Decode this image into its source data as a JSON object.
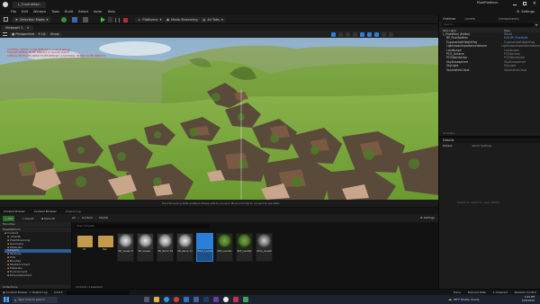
{
  "app": {
    "tab_title": "L_TundraMain",
    "window_title": "PixelPlatform",
    "settings_label": "Settings"
  },
  "menu": [
    "File",
    "Edit",
    "Window",
    "Tools",
    "Build",
    "Select",
    "Actor",
    "Help"
  ],
  "toolbar": {
    "mode_label": "Selection Mode",
    "platforms_label": "Platforms",
    "mode_button_label": "Mode Streaming",
    "tabs_label": "All Tabs"
  },
  "viewport": {
    "tab_label": "Viewport 1",
    "perspective_label": "Perspective",
    "lit_label": "Lit",
    "show_label": "Show",
    "warning_lines": [
      "LIGHTING NEEDS TO BE REBUILT (1 unbuilt object)",
      "FOLIAGE NEEDS TO BE REBUILT (1 unbuilt object)",
      "VIRTUAL TEXTURES NEED TO BE REBUILT (1 MATERIAL NEEDS TO BE REBUILT)"
    ],
    "status_text": "Pixel Streaming stats enabled. Please wait to connect. Move and look to connect to see stats."
  },
  "outliner": {
    "tab_label": "Outliner",
    "tab2_label": "Levels",
    "tab3_label": "Components",
    "search_placeholder": "Search...",
    "col_label": "Item Label",
    "col_type": "Type",
    "rows": [
      {
        "name": "L_PixelMain (Editor)",
        "type": "World"
      },
      {
        "name": "BP_PixelSplitter",
        "type": "Edit BP_PixelSplit"
      },
      {
        "name": "ExponentialHeightFog",
        "type": "ExponentialHeightFog"
      },
      {
        "name": "LightmassImportanceVolume",
        "type": "LightmassImportanceVolume"
      },
      {
        "name": "Landscape",
        "type": "Landscape"
      },
      {
        "name": "PCG_Volume",
        "type": "PCGVolume"
      },
      {
        "name": "PCGWorldActor",
        "type": "PCGWorldActor"
      },
      {
        "name": "SkyAtmosphere",
        "type": "SkyAtmosphere"
      },
      {
        "name": "SkyLight",
        "type": "SkyLight"
      },
      {
        "name": "VolumetricCloud",
        "type": "VolumetricCloud"
      }
    ],
    "footer": "12 actors"
  },
  "details": {
    "tab_label": "Details",
    "tab2_label": "World Settings",
    "empty_text": "Select an object to view details."
  },
  "content_browser": {
    "tab_label": "Content Drawer",
    "tab2_label": "Content Browser",
    "tab3_label": "Output Log",
    "add_label": "Add",
    "import_label": "Import",
    "save_all_label": "Save All",
    "path": [
      "All",
      "Content",
      "PixelTe"
    ],
    "settings_label": "Settings",
    "search_placeholder": "Search PixelTe",
    "favorites_label": "Favorites",
    "tree_root": "PixelPlatform",
    "tree_items": [
      "Content",
      "_PixelTe",
      "PixelStreaming",
      "Geometry",
      "Materials",
      "PixelTe",
      "Textures",
      "PCG",
      "Brushes",
      "StarterContent",
      "Materials",
      "Environment",
      "ExternalContent"
    ],
    "collections_label": "Collections",
    "assets": [
      {
        "name": "M",
        "kind": "folder"
      },
      {
        "name": "Tex",
        "kind": "folder"
      },
      {
        "name": "MI_Grass Mask",
        "kind": "material"
      },
      {
        "name": "MI_Grass",
        "kind": "material"
      },
      {
        "name": "MI_Rock 01",
        "kind": "material"
      },
      {
        "name": "MI_Rock Color",
        "kind": "material"
      },
      {
        "name": "PCG_Landscape",
        "kind": "pcg"
      },
      {
        "name": "SM_Landscape",
        "kind": "sphere"
      },
      {
        "name": "SM_Landscape Mask",
        "kind": "sphere"
      },
      {
        "name": "PCG_Graph",
        "kind": "pcg"
      }
    ],
    "footer": "10 items (1 selected)"
  },
  "bottom_bar": {
    "content_drawer": "Content Drawer",
    "output_log": "Output Log",
    "cmd_label": "Cmd",
    "cmd_placeholder": "Enter Console Command",
    "trace": "Trace",
    "derived_data": "Derived Data",
    "unsaved": "1 Unsaved",
    "revision": "Revision Control"
  },
  "taskbar": {
    "search_placeholder": "Type here to search",
    "weather": "68°F Mostly cloudy",
    "time": "3:24 PM",
    "date": "12/6/2024"
  },
  "colors": {
    "accent": "#2b7fd8",
    "warning_red": "#e03030",
    "folder": "#c59a4a"
  }
}
